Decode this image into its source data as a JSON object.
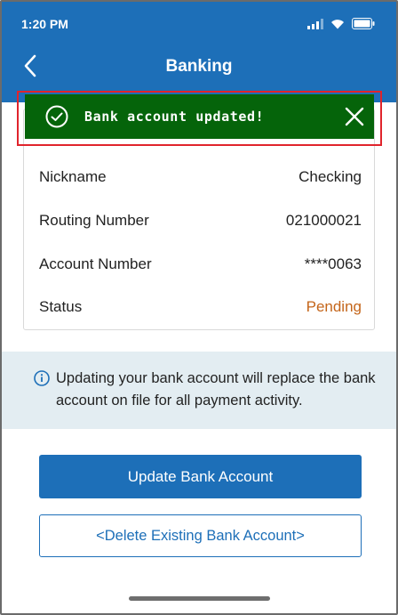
{
  "status_bar": {
    "time": "1:20 PM"
  },
  "nav": {
    "title": "Banking"
  },
  "toast": {
    "message": "Bank account updated!"
  },
  "account": {
    "rows": [
      {
        "label": "Nickname",
        "value": "Checking"
      },
      {
        "label": "Routing Number",
        "value": "021000021"
      },
      {
        "label": "Account Number",
        "value": "****0063"
      },
      {
        "label": "Status",
        "value": "Pending"
      }
    ]
  },
  "info": {
    "text": "Updating your bank account will replace the bank account on file for all payment activity."
  },
  "actions": {
    "update_label": "Update Bank Account",
    "delete_label": "<Delete Existing Bank Account>"
  },
  "colors": {
    "brand_blue": "#1d6fb8",
    "toast_green": "#05640a",
    "pending_orange": "#c4651a",
    "info_background": "#e3edf2",
    "highlight_red": "#e0242c"
  },
  "icons": [
    "signal-icon",
    "wifi-icon",
    "battery-icon",
    "back-chevron-icon",
    "check-circle-icon",
    "close-icon",
    "info-icon"
  ]
}
